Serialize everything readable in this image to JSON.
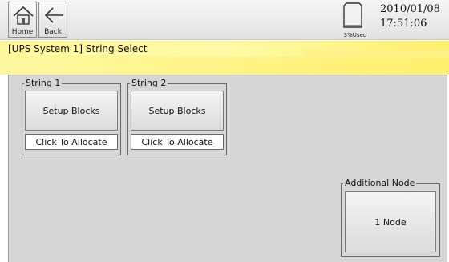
{
  "header": {
    "home_label": "Home",
    "back_label": "Back",
    "storage_used": "3%Used",
    "date": "2010/01/08",
    "time": "17:51:06"
  },
  "title": "[UPS System 1] String Select",
  "strings": [
    {
      "legend": "String 1",
      "button": "Setup Blocks",
      "allocate": "Click To Allocate"
    },
    {
      "legend": "String 2",
      "button": "Setup Blocks",
      "allocate": "Click To Allocate"
    }
  ],
  "additional_node": {
    "legend": "Additional Node",
    "button": "1 Node"
  },
  "icons": {
    "home": "home-icon",
    "back": "back-arrow-icon",
    "storage": "storage-icon"
  }
}
